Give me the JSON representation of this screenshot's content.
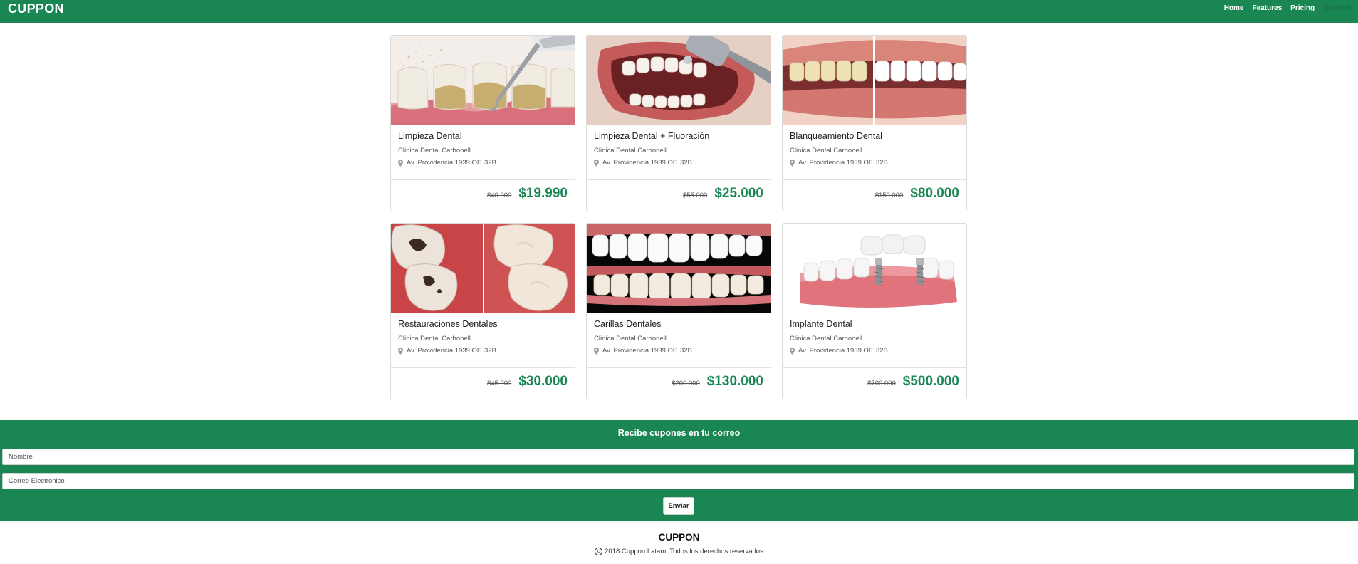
{
  "navbar": {
    "brand": "CUPPON",
    "links": [
      {
        "label": "Home"
      },
      {
        "label": "Features"
      },
      {
        "label": "Pricing"
      },
      {
        "label": "Disabled"
      }
    ]
  },
  "cards": [
    {
      "title": "Limpieza Dental",
      "clinic": "Clinica Dental Carbonell",
      "address": "Av. Providencia 1939 OF. 32B",
      "old_price": "$40.000",
      "price": "$19.990",
      "icon": "dental-cleaning-image"
    },
    {
      "title": "Limpieza Dental + Fluoración",
      "clinic": "Clinica Dental Carbonell",
      "address": "Av. Providencia 1939 OF. 32B",
      "old_price": "$55.000",
      "price": "$25.000",
      "icon": "dental-fluoride-image"
    },
    {
      "title": "Blanqueamiento Dental",
      "clinic": "Clinica Dental Carbonell",
      "address": "Av. Providencia 1939 OF. 32B",
      "old_price": "$150.000",
      "price": "$80.000",
      "icon": "teeth-whitening-image"
    },
    {
      "title": "Restauraciones Dentales",
      "clinic": "Clinica Dental Carbonell",
      "address": "Av. Providencia 1939 OF. 32B",
      "old_price": "$45.000",
      "price": "$30.000",
      "icon": "dental-restoration-image"
    },
    {
      "title": "Carillas Dentales",
      "clinic": "Clinica Dental Carbonell",
      "address": "Av. Providencia 1939 OF. 32B",
      "old_price": "$200.000",
      "price": "$130.000",
      "icon": "dental-veneers-image"
    },
    {
      "title": "Implante Dental",
      "clinic": "Clinica Dental Carbonell",
      "address": "Av. Providencia 1939 OF. 32B",
      "old_price": "$700.000",
      "price": "$500.000",
      "icon": "dental-implant-image"
    }
  ],
  "newsletter": {
    "title": "Recibe cupones en tu correo",
    "name_placeholder": "Nombre",
    "email_placeholder": "Correo Electrónico",
    "submit_label": "Enviar"
  },
  "footer": {
    "brand": "CUPPON",
    "copyright": "2018 Cuppon Latam. Todos los derechos reservados"
  },
  "colors": {
    "brand_green": "#1a8654",
    "price_green": "#1a8654"
  }
}
